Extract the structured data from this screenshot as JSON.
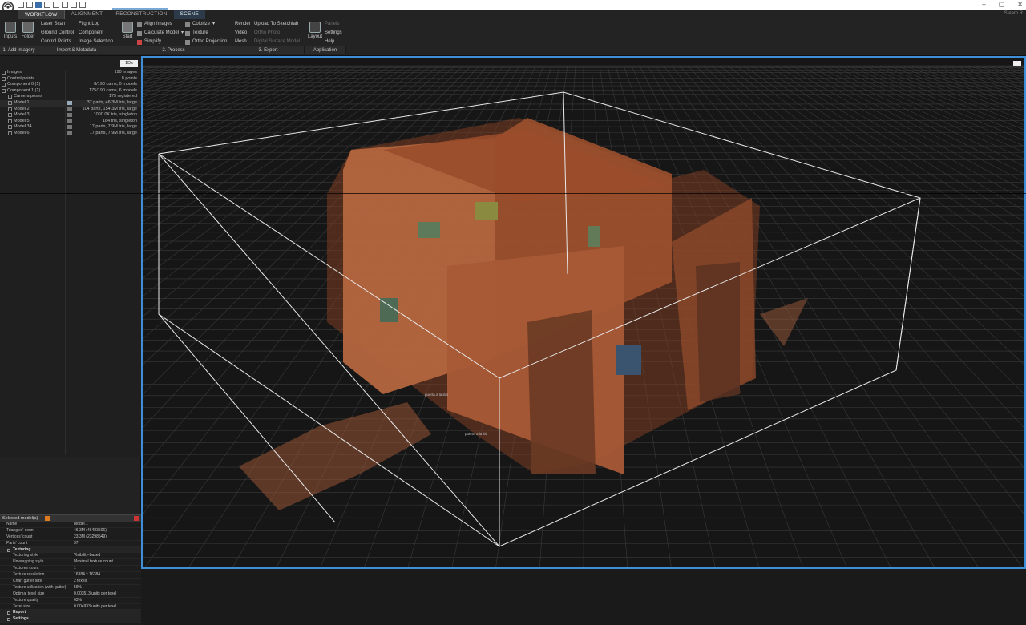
{
  "app": {
    "tab_title": "",
    "username": "Steam R"
  },
  "ribbon": {
    "tabs": [
      "WORKFLOW",
      "ALIGNMENT",
      "RECONSTRUCTION",
      "SCENE"
    ],
    "add_imagery": {
      "inputs": "Inputs",
      "folder": "Folder"
    },
    "import": {
      "col1": [
        "Laser Scan",
        "Ground Control",
        "Control Points"
      ],
      "col2": [
        "Flight Log",
        "Component",
        "Image Selection"
      ]
    },
    "start": "Start",
    "process": {
      "col1": [
        "Align Images",
        "Calculate Model",
        "Simplify"
      ],
      "col2": [
        "Colorize",
        "Texture",
        "Ortho Projection"
      ]
    },
    "export": {
      "col1": [
        "Render",
        "Video",
        "Mesh"
      ],
      "col2": [
        "Upload To Sketchfab",
        "Ortho Photo",
        "Digital Surface Model"
      ]
    },
    "layout": "Layout",
    "application": [
      "Panels",
      "Settings",
      "Help"
    ],
    "groups": [
      "1. Add imagery",
      "Import & Metadata",
      "2. Process",
      "3. Export",
      "Application"
    ]
  },
  "tree": {
    "button": "1Ds",
    "rows": [
      {
        "name": "Images",
        "value": "190 images",
        "indent": 0
      },
      {
        "name": "Control points",
        "value": "8 points",
        "indent": 0
      },
      {
        "name": "Component 0 (1)",
        "value": "8/190 cams, 0 models",
        "indent": 0
      },
      {
        "name": "Component 1 (1)",
        "value": "175/190 cams, 6 models",
        "indent": 0
      },
      {
        "name": "Camera poses",
        "value": "175 registered",
        "indent": 1
      },
      {
        "name": "Model 1",
        "value": "37 parts, 46.3M tris, large",
        "indent": 1
      },
      {
        "name": "Model 2",
        "value": "104 parts, 154.3M tris, large",
        "indent": 1
      },
      {
        "name": "Model 3",
        "value": "1000.0K tris, singleton",
        "indent": 1
      },
      {
        "name": "Model 5",
        "value": "184 tris, singleton",
        "indent": 1
      },
      {
        "name": "Model 34",
        "value": "17 parts, 7.9M tris, large",
        "indent": 1
      },
      {
        "name": "Model 6",
        "value": "17 parts, 7.9M tris, large",
        "indent": 1
      }
    ]
  },
  "props": {
    "title": "Selected model(s)",
    "rows": [
      {
        "k": "Name",
        "v": "Model 1"
      },
      {
        "k": "Triangles' count",
        "v": "46.3M (46483506)"
      },
      {
        "k": "Vertices' count",
        "v": "23.3M (23298549)"
      },
      {
        "k": "Parts' count",
        "v": "37"
      },
      {
        "k": "Texturing",
        "v": "",
        "section": true
      },
      {
        "k": "Texturing style",
        "v": "Visibility-based",
        "inner": true
      },
      {
        "k": "Unwrapping style",
        "v": "Maximal texture count",
        "inner": true
      },
      {
        "k": "Textures count",
        "v": "1",
        "inner": true
      },
      {
        "k": "Texture resolution",
        "v": "16384 x 16384",
        "inner": true
      },
      {
        "k": "Chart gutter size",
        "v": "2 texels",
        "inner": true
      },
      {
        "k": "Texture utilization (with gutter)",
        "v": "59%",
        "inner": true
      },
      {
        "k": "Optimal texel size",
        "v": "0.003513 units per texel",
        "inner": true
      },
      {
        "k": "Texture quality",
        "v": "63%",
        "inner": true
      },
      {
        "k": "Texel size",
        "v": "0.004933 units per texel",
        "inner": true
      },
      {
        "k": "Report",
        "v": "",
        "section": true
      },
      {
        "k": "Settings",
        "v": "",
        "section": true
      }
    ]
  },
  "viewport": {
    "labels": [
      "puerta a la ibis",
      "puerta a la ibij"
    ]
  },
  "colors": {
    "accent": "#3f8fd8",
    "model": "#b06038",
    "grid": "#3a3a3a"
  }
}
